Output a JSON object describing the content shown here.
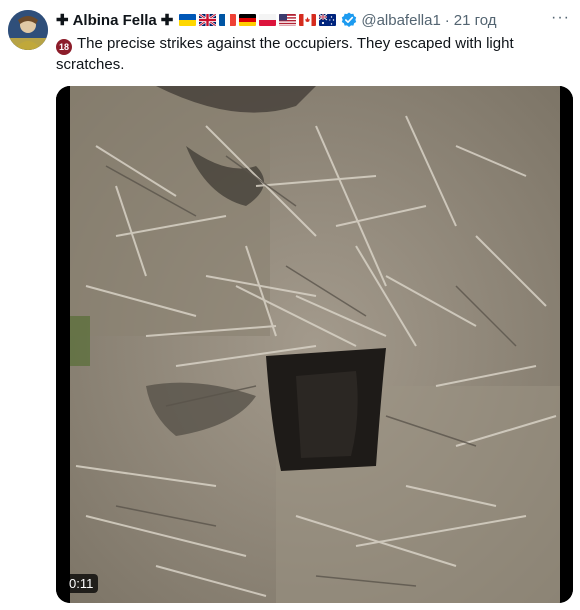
{
  "post": {
    "author_prefix": "✚",
    "author_name": "Albina Fella",
    "author_suffix": "✚",
    "flags": [
      "ukraine-flag",
      "uk-flag",
      "france-flag",
      "germany-flag",
      "poland-flag",
      "usa-flag",
      "canada-flag",
      "australia-flag"
    ],
    "handle": "@albafella1",
    "separator": "·",
    "time": "21 год",
    "more_label": "···",
    "age_badge": "18",
    "text": "The precise strikes against the occupiers. They escaped with light scratches.",
    "video_duration": "0:11"
  },
  "colors": {
    "accent": "#1d9bf0",
    "secondary_text": "#536471",
    "badge_red": "#8c1d2a"
  }
}
